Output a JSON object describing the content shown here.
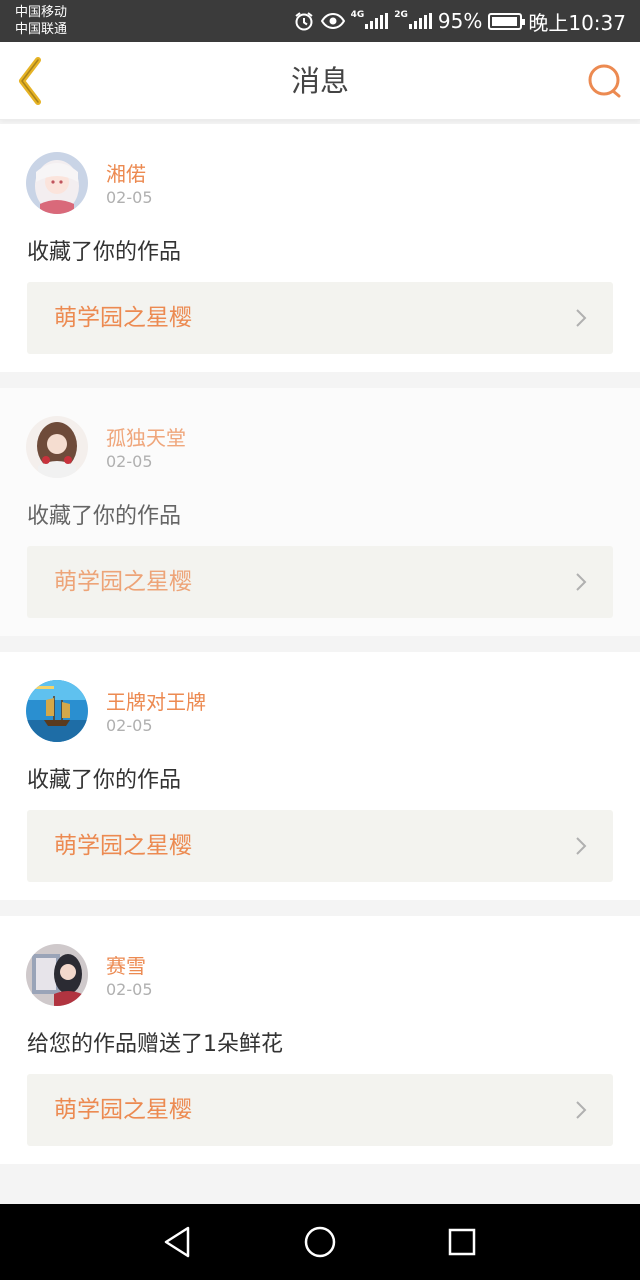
{
  "status_bar": {
    "carrier_1": "中国移动",
    "carrier_2": "中国联通",
    "network_1": "4G",
    "network_2": "2G",
    "battery": "95%",
    "battery_level": 0.95,
    "time": "晚上10:37",
    "icons": [
      "alarm-icon",
      "eye-icon",
      "signal-icon",
      "battery-icon"
    ]
  },
  "header": {
    "title": "消息",
    "back_icon": "chevron-left-icon",
    "search_icon": "search-icon",
    "accent_color": "#ec8a51",
    "back_icon_color": "#e6b325"
  },
  "messages": [
    {
      "user": "湘偌",
      "date": "02-05",
      "action": "收藏了你的作品",
      "work": "萌学园之星樱"
    },
    {
      "user": "孤独天堂",
      "date": "02-05",
      "action": "收藏了你的作品",
      "work": "萌学园之星樱"
    },
    {
      "user": "王牌对王牌",
      "date": "02-05",
      "action": "收藏了你的作品",
      "work": "萌学园之星樱"
    },
    {
      "user": "赛雪",
      "date": "02-05",
      "action": "给您的作品赠送了1朵鲜花",
      "work": "萌学园之星樱"
    }
  ],
  "nav": {
    "icons": [
      "back-triangle-icon",
      "home-circle-icon",
      "recents-square-icon"
    ]
  }
}
